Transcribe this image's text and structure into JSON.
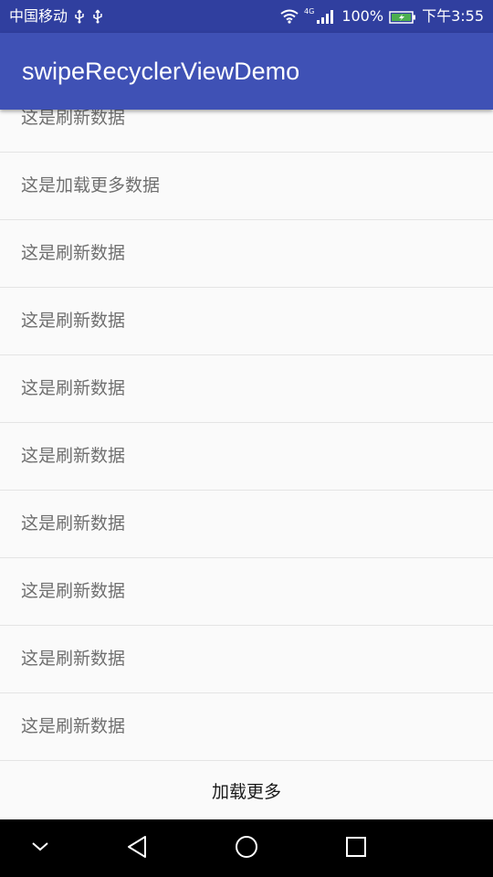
{
  "status_bar": {
    "carrier": "中国移动",
    "network_type": "4G",
    "battery": "100%",
    "time": "下午3:55",
    "icons": [
      "usb-icon",
      "usb-icon",
      "wifi-icon",
      "signal-icon",
      "battery-charging-icon"
    ]
  },
  "app_bar": {
    "title": "swipeRecyclerViewDemo",
    "color": "#3f51b5"
  },
  "list": {
    "items": [
      {
        "label": "这是刷新数据"
      },
      {
        "label": "这是加载更多数据"
      },
      {
        "label": "这是刷新数据"
      },
      {
        "label": "这是刷新数据"
      },
      {
        "label": "这是刷新数据"
      },
      {
        "label": "这是刷新数据"
      },
      {
        "label": "这是刷新数据"
      },
      {
        "label": "这是刷新数据"
      },
      {
        "label": "这是刷新数据"
      },
      {
        "label": "这是刷新数据"
      }
    ],
    "footer_label": "加载更多"
  },
  "nav_bar": {
    "buttons": [
      "chevron-down-icon",
      "back-icon",
      "home-icon",
      "recents-icon"
    ]
  }
}
